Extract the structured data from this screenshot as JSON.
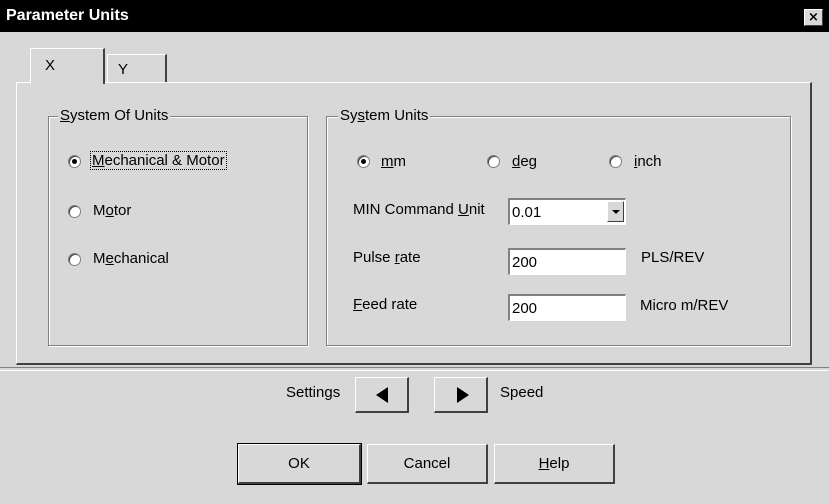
{
  "window": {
    "title": "Parameter Units",
    "close_glyph": "×"
  },
  "tabs": [
    {
      "label": "X",
      "selected": true
    },
    {
      "label": "Y",
      "selected": false
    }
  ],
  "system_of_units": {
    "legend_prefix": "",
    "legend_mnemonic": "S",
    "legend_rest": "ystem Of Units",
    "options": [
      {
        "pre": "",
        "mnemonic": "M",
        "post": "echanical & Motor",
        "checked": true
      },
      {
        "pre": "M",
        "mnemonic": "o",
        "post": "tor",
        "checked": false
      },
      {
        "pre": "M",
        "mnemonic": "e",
        "post": "chanical",
        "checked": false
      }
    ]
  },
  "system_units": {
    "legend_pre": "Sy",
    "legend_mnemonic": "s",
    "legend_rest": "tem Units",
    "units": [
      {
        "pre": "",
        "mnemonic": "m",
        "post": "m",
        "checked": true
      },
      {
        "pre": "",
        "mnemonic": "d",
        "post": "eg",
        "checked": false
      },
      {
        "pre": "",
        "mnemonic": "i",
        "post": "nch",
        "checked": false
      }
    ],
    "min_command": {
      "pre": "MIN Command ",
      "mnemonic": "U",
      "post": "nit",
      "value": "0.01"
    },
    "pulse_rate": {
      "pre": "Pulse ",
      "mnemonic": "r",
      "post": "ate",
      "value": "200",
      "unit": "PLS/REV"
    },
    "feed_rate": {
      "pre": "",
      "mnemonic": "F",
      "post": "eed rate",
      "value": "200",
      "unit": "Micro m/REV"
    }
  },
  "nav": {
    "left_label": "Settings",
    "right_label": "Speed"
  },
  "buttons": {
    "ok": "OK",
    "cancel": "Cancel",
    "help_mnemonic": "H",
    "help_rest": "elp"
  }
}
